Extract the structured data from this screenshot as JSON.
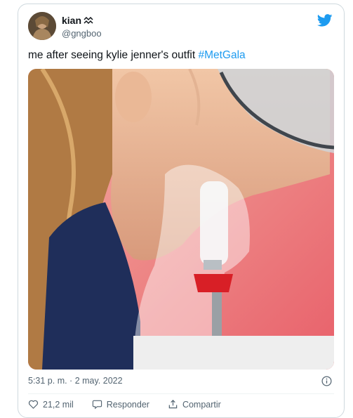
{
  "tweet": {
    "display_name": "kian",
    "handle": "@gngboo",
    "text_prefix": "me after seeing kylie jenner's outfit ",
    "hashtag": "#MetGala",
    "timestamp": "5:31 p. m. · 2 may. 2022"
  },
  "actions": {
    "like_count": "21,2 mil",
    "reply_label": "Responder",
    "share_label": "Compartir"
  },
  "icons": {
    "brand": "twitter-bird-icon",
    "info": "info-icon",
    "like": "heart-icon",
    "reply": "reply-bubble-icon",
    "share": "share-icon"
  },
  "colors": {
    "link": "#1d9bf0",
    "secondary_text": "#536471",
    "border": "#cfd9de"
  }
}
